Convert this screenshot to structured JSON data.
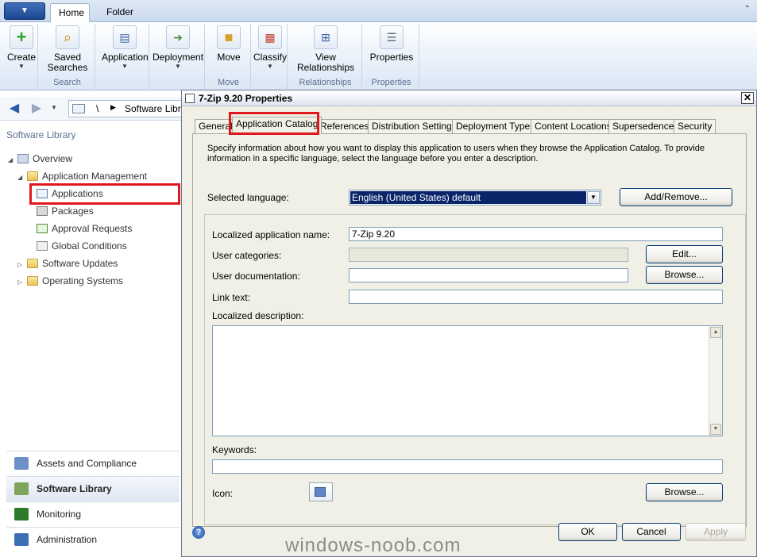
{
  "ribbon": {
    "tabs": [
      {
        "label": "Home",
        "selected": true
      },
      {
        "label": "Folder",
        "selected": false
      }
    ],
    "groups": [
      {
        "label": "",
        "buttons": [
          {
            "label": "Create",
            "icon": "plus-icon"
          }
        ]
      },
      {
        "label": "Search",
        "buttons": [
          {
            "label": "Saved Searches",
            "icon": "saved-search-icon"
          }
        ]
      },
      {
        "label": "",
        "buttons": [
          {
            "label": "Application",
            "icon": "application-icon"
          }
        ]
      },
      {
        "label": "",
        "buttons": [
          {
            "label": "Deployment",
            "icon": "deployment-icon"
          }
        ]
      },
      {
        "label": "Move",
        "buttons": [
          {
            "label": "Move",
            "icon": "move-folder-icon"
          }
        ]
      },
      {
        "label": "",
        "buttons": [
          {
            "label": "Classify",
            "icon": "classify-icon"
          }
        ]
      },
      {
        "label": "Relationships",
        "buttons": [
          {
            "label": "View Relationships",
            "icon": "relationships-icon"
          }
        ]
      },
      {
        "label": "Properties",
        "buttons": [
          {
            "label": "Properties",
            "icon": "properties-icon"
          }
        ]
      }
    ]
  },
  "navbar": {
    "separator1": "\\",
    "separator2": "▶",
    "path": "Software Library"
  },
  "left_pane": {
    "title": "Software Library",
    "tree": [
      {
        "label": "Overview",
        "level": 0,
        "expander": "◢",
        "icon": "overview-icon"
      },
      {
        "label": "Application Management",
        "level": 1,
        "expander": "◢",
        "icon": "folder-icon"
      },
      {
        "label": "Applications",
        "level": 2,
        "expander": "",
        "icon": "applications-icon",
        "selected": true
      },
      {
        "label": "Packages",
        "level": 2,
        "expander": "",
        "icon": "packages-icon"
      },
      {
        "label": "Approval Requests",
        "level": 2,
        "expander": "",
        "icon": "approval-icon"
      },
      {
        "label": "Global Conditions",
        "level": 2,
        "expander": "",
        "icon": "global-conditions-icon"
      },
      {
        "label": "Software Updates",
        "level": 1,
        "expander": "▷",
        "icon": "folder-icon"
      },
      {
        "label": "Operating Systems",
        "level": 1,
        "expander": "▷",
        "icon": "folder-icon"
      }
    ],
    "wunderbar": [
      {
        "label": "Assets and Compliance",
        "icon": "assets-icon",
        "color": "#6b8fc7"
      },
      {
        "label": "Software Library",
        "icon": "software-library-icon",
        "color": "#7ea35b",
        "active": true
      },
      {
        "label": "Monitoring",
        "icon": "monitoring-icon",
        "color": "#2c7a2c"
      },
      {
        "label": "Administration",
        "icon": "administration-icon",
        "color": "#3d6fb6"
      }
    ]
  },
  "dialog": {
    "title": "7-Zip 9.20 Properties",
    "close_glyph": "✕",
    "tabs": [
      "General",
      "Application Catalog",
      "References",
      "Distribution Settings",
      "Deployment Types",
      "Content Locations",
      "Supersedence",
      "Security"
    ],
    "selected_tab": "Application Catalog",
    "intro": "Specify information about how you want to display this application to users when they browse the Application Catalog. To provide information in a specific language, select the language before you enter a description.",
    "selected_language_label": "Selected language:",
    "selected_language_value": "English (United States) default",
    "add_remove_label": "Add/Remove...",
    "fields": {
      "localized_name_label": "Localized application name:",
      "localized_name_value": "7-Zip 9.20",
      "user_categories_label": "User categories:",
      "user_categories_value": "",
      "edit_label": "Edit...",
      "user_documentation_label": "User documentation:",
      "user_documentation_value": "",
      "browse_doc_label": "Browse...",
      "link_text_label": "Link text:",
      "link_text_value": "",
      "localized_description_label": "Localized description:",
      "localized_description_value": "",
      "keywords_label": "Keywords:",
      "keywords_value": "",
      "icon_label": "Icon:",
      "browse_icon_label": "Browse..."
    },
    "buttons": {
      "ok": "OK",
      "cancel": "Cancel",
      "apply": "Apply"
    },
    "help_glyph": "?"
  },
  "watermark": "windows-noob.com",
  "colors": {
    "highlight": "#e2161d",
    "selection": "#0a246a"
  }
}
